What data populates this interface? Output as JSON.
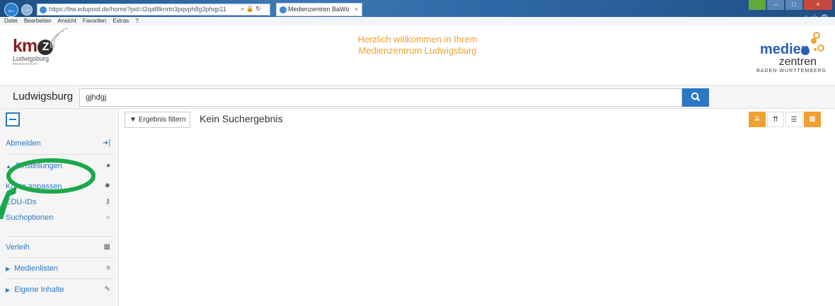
{
  "browser": {
    "url": "https://bw.edupool.de/home?pid=l2qaf8knrtn3pqvph8g3phqp11",
    "tab_title": "Medienzentren BaWü",
    "menu": [
      "Datei",
      "Bearbeiten",
      "Ansicht",
      "Favoriten",
      "Extras",
      "?"
    ]
  },
  "header": {
    "kmz_letters": "km",
    "kmz_z": "Z",
    "kmz_city": "Ludwigsburg",
    "kmz_tagline": "Medienzentrum",
    "welcome_line1": "Herzlich willkommen in Ihrem",
    "welcome_line2": "Medienzentrum Ludwigsburg",
    "mz_word1": "medien",
    "mz_word2": "zentren",
    "mz_word3": "BADEN-WÜRTTEMBERG"
  },
  "search": {
    "location_label": "Ludwigsburg",
    "query": "gjhdgj"
  },
  "sidebar": {
    "items": [
      {
        "label": "Abmelden",
        "icon": "sign-in-icon"
      },
      {
        "label": "Einstellungen",
        "icon": "user-icon"
      },
      {
        "label": "Konto anpassen",
        "icon": "gear-icon"
      },
      {
        "label": "EDU-IDs",
        "icon": "key-icon"
      },
      {
        "label": "Suchoptionen",
        "icon": "search-icon"
      },
      {
        "label": "Verleih",
        "icon": "calendar-icon"
      },
      {
        "label": "Medienlisten",
        "icon": "list-icon"
      },
      {
        "label": "Eigene Inhalte",
        "icon": "edit-icon"
      }
    ]
  },
  "main": {
    "filter_label": "Ergebnis filtern",
    "result_text": "Kein Suchergebnis"
  },
  "colors": {
    "accent_blue": "#2c78c4",
    "accent_orange": "#f0a030",
    "annotation_green": "#1aa84a"
  }
}
